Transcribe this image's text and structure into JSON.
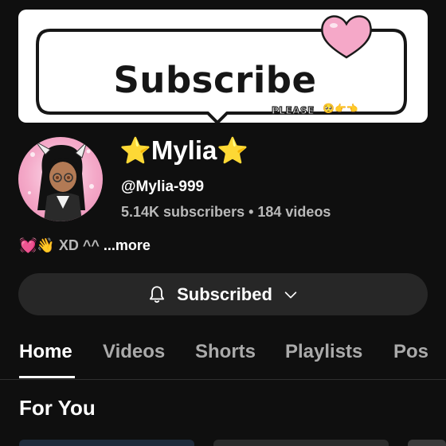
{
  "banner": {
    "text": "Subscribe",
    "please_text": "PLEASE",
    "emoji": "🥺👉👈"
  },
  "channel": {
    "star_left": "⭐",
    "name": "Mylia",
    "star_right": "⭐",
    "handle": "@Mylia-999",
    "stats": "5.14K subscribers • 184 videos",
    "bio_emoji": "💓👋",
    "bio_text": "XD ^^",
    "bio_more": "...more"
  },
  "subscribe_button": {
    "label": "Subscribed",
    "icon": "bell-icon",
    "chevron": "chevron-down-icon"
  },
  "tabs": [
    {
      "label": "Home",
      "active": true
    },
    {
      "label": "Videos",
      "active": false
    },
    {
      "label": "Shorts",
      "active": false
    },
    {
      "label": "Playlists",
      "active": false
    },
    {
      "label": "Pos",
      "active": false
    }
  ],
  "section": {
    "title": "For You"
  },
  "colors": {
    "background": "#0f0f0f",
    "button_bg": "#272727",
    "muted_text": "#aaaaaa",
    "heart_pink": "#f5a8c8",
    "star_yellow": "#f7c531"
  }
}
